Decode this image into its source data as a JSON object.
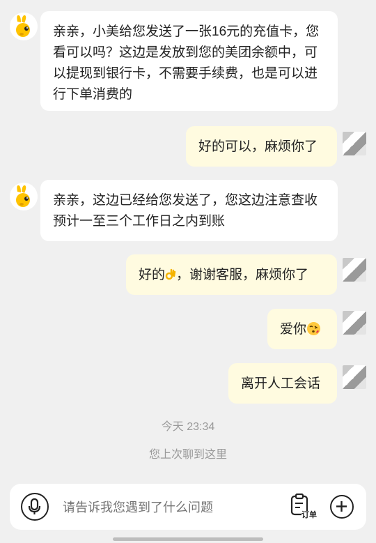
{
  "messages": [
    {
      "side": "left",
      "text": "亲亲，小美给您发送了一张16元的充值卡，您看可以吗？这边是发放到您的美团余额中，可以提现到银行卡，不需要手续费，也是可以进行下单消费的"
    },
    {
      "side": "right",
      "text": "好的可以，麻烦你了"
    },
    {
      "side": "left",
      "text": "亲亲，这边已经给您发送了，您这边注意查收预计一至三个工作日之内到账"
    },
    {
      "side": "right",
      "text_before": "好的",
      "emoji": "ok-hand-emoji",
      "text_after": "，谢谢客服，麻烦你了"
    },
    {
      "side": "right",
      "text": "爱你",
      "emoji": "kiss-face-emoji"
    },
    {
      "side": "right",
      "text": "离开人工会话"
    }
  ],
  "timestamp": "今天 23:34",
  "last_chat_notice": "您上次聊到这里",
  "input": {
    "placeholder": "请告诉我您遇到了什么问题",
    "order_label": "订单"
  },
  "colors": {
    "background": "#f0f0f0",
    "incoming_bubble": "#ffffff",
    "outgoing_bubble": "#fffbe0",
    "bot_yellow": "#ffc300"
  }
}
